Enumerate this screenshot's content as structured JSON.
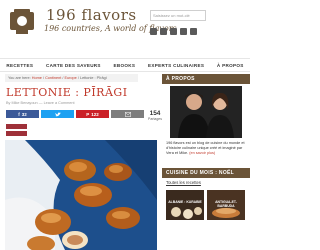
{
  "header": {
    "site_name": "196 flavors",
    "tagline": "196 countries, A world of flavors",
    "search_placeholder": "Saisissez un mot-clé",
    "social": [
      "facebook",
      "instagram",
      "pinterest",
      "twitter",
      "youtube"
    ]
  },
  "nav": {
    "items": [
      "RECETTES",
      "CARTE DES SAVEURS",
      "EBOOKS",
      "EXPERTS CULINAIRES",
      "À PROPOS"
    ]
  },
  "breadcrumb": {
    "prefix": "You are here:",
    "home": "Home",
    "sep1": "/",
    "continent": "Continent",
    "sep2": "/",
    "region": "Europe",
    "sep3": "/",
    "current": "Lettonie : Pīrāgi"
  },
  "post": {
    "title": "LETTONIE : PĪRĀGI",
    "byline": "By Mike Benayoun — Leave a Comment"
  },
  "share": {
    "buttons": [
      {
        "icon": "facebook-icon",
        "count": "32",
        "color": "#3b5998"
      },
      {
        "icon": "twitter-icon",
        "count": "",
        "color": "#1da1f2"
      },
      {
        "icon": "pinterest-icon",
        "count": "122",
        "color": "#cb2027"
      },
      {
        "icon": "email-icon",
        "count": "",
        "color": "#7d7d7d"
      }
    ],
    "total": "154",
    "total_label": "Partages"
  },
  "sidebar": {
    "about_heading": "À PROPOS",
    "about_text_before": "196 flavors est un blog de cuisine du monde et d'histoire culinaire unique créé et imaginé par Vera et Mike.",
    "about_link": "(en savoir plus)",
    "recipes_heading": "CUISINE DU MOIS : NOËL",
    "all_recipes": "Toutes les recettes",
    "thumbs": [
      "ALBANIE : KURABIE",
      "ANTIGUA-ET-BARBUDA"
    ]
  },
  "colors": {
    "brand": "#6b5438",
    "accent": "#c0392b",
    "photo_bg": "#1d4f8c"
  }
}
